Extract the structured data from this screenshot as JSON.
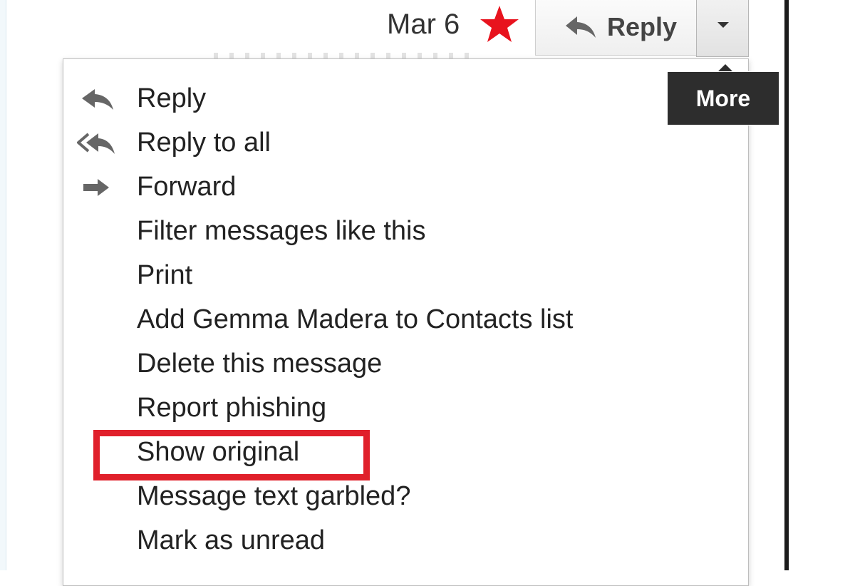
{
  "header": {
    "date": "Mar 6",
    "reply_label": "Reply",
    "star_color": "#e8131e"
  },
  "tooltip": {
    "text": "More"
  },
  "menu": {
    "items": [
      {
        "label": "Reply",
        "icon": "reply-icon"
      },
      {
        "label": "Reply to all",
        "icon": "reply-all-icon"
      },
      {
        "label": "Forward",
        "icon": "forward-icon"
      },
      {
        "label": "Filter messages like this"
      },
      {
        "label": "Print"
      },
      {
        "label": "Add Gemma Madera to Contacts list"
      },
      {
        "label": "Delete this message"
      },
      {
        "label": "Report phishing"
      },
      {
        "label": "Show original",
        "highlighted": true
      },
      {
        "label": "Message text garbled?"
      },
      {
        "label": "Mark as unread"
      }
    ]
  },
  "colors": {
    "highlight": "#e0202b",
    "tooltip_bg": "#2d2d2d",
    "icon_gray": "#666666"
  }
}
